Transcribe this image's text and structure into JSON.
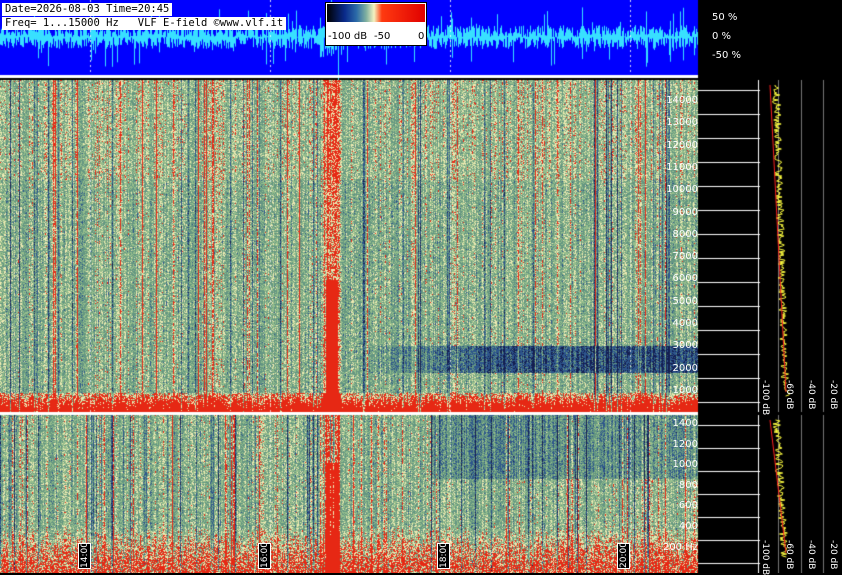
{
  "header": {
    "line1": "Date=2026-08-03 Time=20:45",
    "line2": "Freq= 1...15000 Hz   VLF E-field ©www.vlf.it"
  },
  "colorbar": {
    "labels": [
      "-100 dB",
      "-50",
      "0"
    ]
  },
  "waveform": {
    "labels": [
      "50 %",
      "0 %",
      "-50 %"
    ]
  },
  "spectrum_upper": {
    "freq_labels": [
      "14000",
      "13000",
      "12000",
      "11000",
      "10000",
      "9000",
      "8000",
      "7000",
      "6000",
      "5000",
      "4000",
      "3000",
      "2000",
      "1000"
    ],
    "db_labels": [
      "-100 dB",
      "-60 dB",
      "-40 dB",
      "-20 dB"
    ]
  },
  "spectrum_lower": {
    "freq_labels": [
      "1400",
      "1200",
      "1000",
      "800",
      "600",
      "400",
      "200 Hz"
    ],
    "db_labels": [
      "-100 dB",
      "-60 dB",
      "-40 dB",
      "-20 dB"
    ]
  },
  "time_labels": [
    "14:00",
    "16:00",
    "18:00",
    "20:00"
  ],
  "colors": {
    "waveform_bg": "#0000ff",
    "waveform_trace": "#38e0ff",
    "accent_red": "#ff1a00"
  }
}
